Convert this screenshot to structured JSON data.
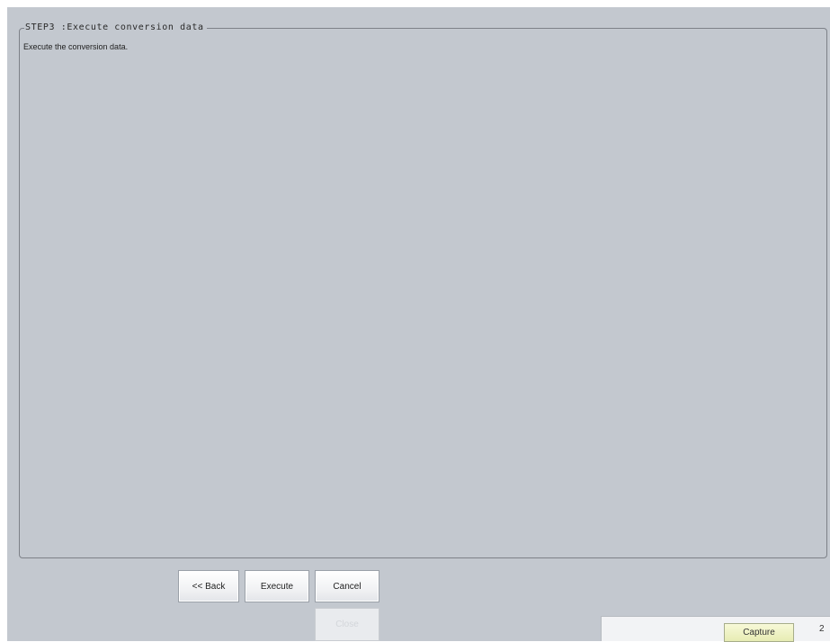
{
  "step": {
    "title": "STEP3 :Execute conversion data",
    "description": "Execute the conversion data."
  },
  "buttons": {
    "back": "<< Back",
    "execute": "Execute",
    "cancel": "Cancel",
    "disabled_label": "Close"
  },
  "toolbar": {
    "capture": "Capture",
    "edge_fragment": "2"
  }
}
